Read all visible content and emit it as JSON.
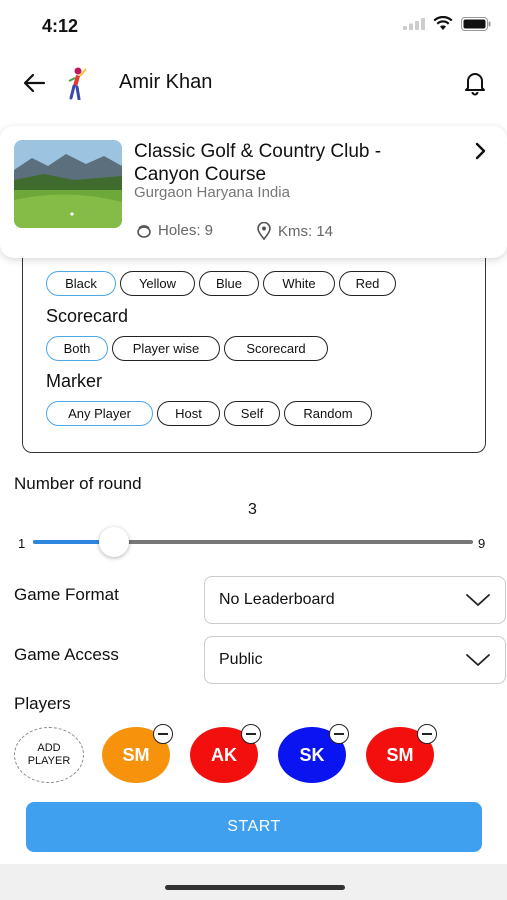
{
  "status_bar": {
    "time": "4:12"
  },
  "header": {
    "user_name": "Amir Khan"
  },
  "course": {
    "name": "Classic Golf & Country Club - Canyon Course",
    "location": "Gurgaon Haryana India",
    "holes": "Holes: 9",
    "kms": "Kms: 14"
  },
  "tees": {
    "options": [
      "Black",
      "Yellow",
      "Blue",
      "White",
      "Red"
    ],
    "selected": "Black"
  },
  "scorecard": {
    "label": "Scorecard",
    "options": [
      "Both",
      "Player wise",
      "Scorecard"
    ],
    "selected": "Both"
  },
  "marker": {
    "label": "Marker",
    "options": [
      "Any Player",
      "Host",
      "Self",
      "Random"
    ],
    "selected": "Any Player"
  },
  "rounds": {
    "label": "Number of round",
    "value": "3",
    "min": "1",
    "max": "9"
  },
  "game_format": {
    "label": "Game Format",
    "value": "No Leaderboard"
  },
  "game_access": {
    "label": "Game Access",
    "value": "Public"
  },
  "players": {
    "label": "Players",
    "add_label_1": "ADD",
    "add_label_2": "PLAYER",
    "list": [
      {
        "initials": "SM",
        "color": "#f7920d"
      },
      {
        "initials": "AK",
        "color": "#f40f0f"
      },
      {
        "initials": "SK",
        "color": "#0a14f0"
      },
      {
        "initials": "SM",
        "color": "#f40f0f"
      }
    ]
  },
  "start_label": "START"
}
